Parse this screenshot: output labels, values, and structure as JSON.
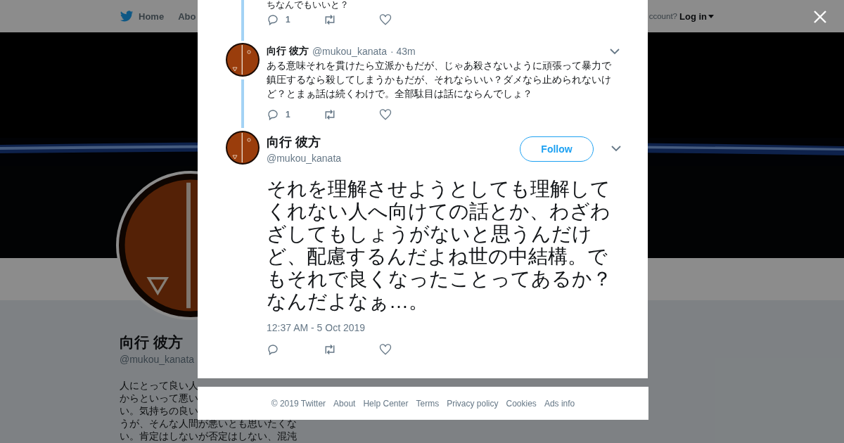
{
  "nav": {
    "items": [
      {
        "label": "Home"
      },
      {
        "label": "Abo"
      }
    ],
    "account_prompt": "ccount?",
    "login": "Log in"
  },
  "profile": {
    "name": "向行 彼方",
    "handle": "@mukou_kanata",
    "bio_lines": [
      "人にとって良い人",
      "からといって悪い",
      "い。気持ちの良い",
      "うが、そんな人間が悪いとも思いたくな",
      "い。肯定はしないが否定はしない、混沌"
    ]
  },
  "thread": {
    "cut_text": "ちなんでもいいと？",
    "cut_replies": "1",
    "tweets": [
      {
        "name": "向行 彼方",
        "handle": "@mukou_kanata",
        "time": "· 43m",
        "text": "ある意味それを貫けたら立派かもだが、じゃあ殺さないように頑張って暴力で鎮圧するなら殺してしまうかもだが、それならいい？ダメなら止められないけど？とまぁ話は続くわけで。全部駄目は話にならんでしょ？",
        "replies": "1"
      }
    ]
  },
  "focused": {
    "name": "向行 彼方",
    "handle": "@mukou_kanata",
    "follow": "Follow",
    "text": "それを理解させようとしても理解してくれない人へ向けての話とか、わざわざしてもしょうがないと思うんだけど、配慮するんだよね世の中結構。でもそれで良くなったことってあるか？なんだよなぁ…。",
    "timestamp": "12:37 AM - 5 Oct 2019"
  },
  "footer": [
    "© 2019 Twitter",
    "About",
    "Help Center",
    "Terms",
    "Privacy policy",
    "Cookies",
    "Ads info"
  ]
}
